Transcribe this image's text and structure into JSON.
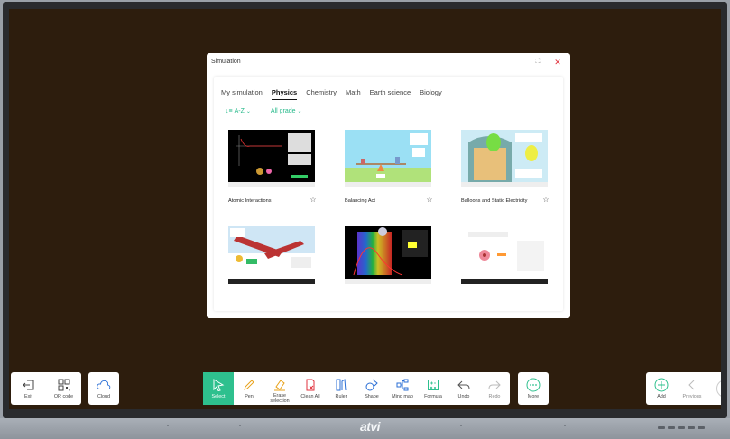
{
  "dialog": {
    "title": "Simulation",
    "expand_icon": "expand-icon",
    "close_icon": "close-icon",
    "tabs": [
      "My simulation",
      "Physics",
      "Chemistry",
      "Math",
      "Earth science",
      "Biology"
    ],
    "active_tab": "Physics",
    "sort_label": "A-Z",
    "grade_label": "All grade",
    "accent": "#25b98a",
    "cards": [
      {
        "title": "Atomic Interactions"
      },
      {
        "title": "Balancing Act"
      },
      {
        "title": "Balloons and Static Electricity"
      },
      {
        "title": ""
      },
      {
        "title": ""
      },
      {
        "title": ""
      }
    ]
  },
  "toolbar": {
    "left": [
      {
        "label": "Exit",
        "icon": "exit-icon"
      },
      {
        "label": "QR code",
        "icon": "qr-code-icon"
      }
    ],
    "cloud": {
      "label": "Cloud",
      "icon": "cloud-icon"
    },
    "center": [
      {
        "label": "Select",
        "icon": "select-icon"
      },
      {
        "label": "Pen",
        "icon": "pen-icon"
      },
      {
        "label": "Erase selection",
        "icon": "eraser-icon"
      },
      {
        "label": "Clean All",
        "icon": "clean-all-icon"
      },
      {
        "label": "Ruler",
        "icon": "ruler-icon"
      },
      {
        "label": "Shape",
        "icon": "shape-icon"
      },
      {
        "label": "Mind map",
        "icon": "mind-map-icon"
      },
      {
        "label": "Formula",
        "icon": "formula-icon"
      },
      {
        "label": "Undo",
        "icon": "undo-icon"
      },
      {
        "label": "Redo",
        "icon": "redo-icon"
      }
    ],
    "more": {
      "label": "More",
      "icon": "more-icon"
    },
    "right": [
      {
        "label": "Add",
        "icon": "add-page-icon"
      },
      {
        "label": "Previous",
        "icon": "previous-icon"
      }
    ],
    "accent": "#2ec08e"
  },
  "device": {
    "brand": "atvi"
  }
}
